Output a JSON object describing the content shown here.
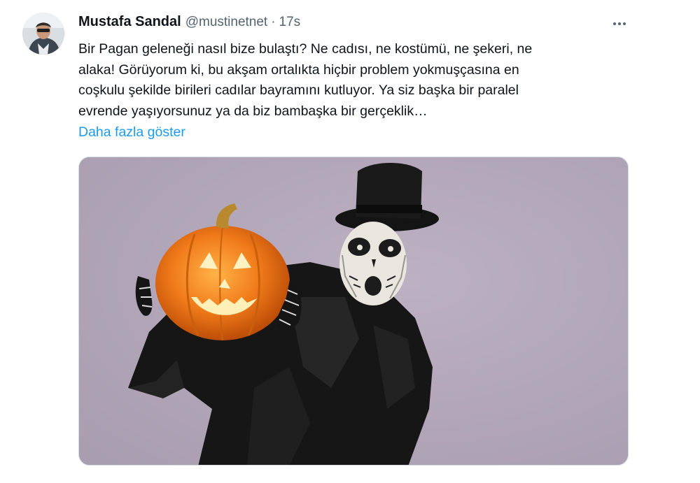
{
  "tweet": {
    "author": {
      "display_name": "Mustafa Sandal",
      "handle": "@mustinetnet",
      "separator": "·",
      "time": "17s"
    },
    "text_lines": [
      "Bir Pagan geleneği nasıl bize bulaştı? Ne cadısı, ne kostümü, ne şekeri, ne",
      "alaka! Görüyorum ki, bu akşam ortalıkta hiçbir problem yokmuşçasına en",
      "coşkulu şekilde birileri cadılar bayramını kutluyor. Ya siz başka bir paralel",
      "evrende yaşıyorsunuz ya da biz bambaşka bir gerçeklik…"
    ],
    "show_more_label": "Daha fazla göster",
    "more_icon": "more-horizontal-icon"
  },
  "colors": {
    "text": "#0f1419",
    "secondary": "#536471",
    "link": "#1d9bf0",
    "media_background": "#b2a6b8",
    "pumpkin": "#f07a1a"
  }
}
